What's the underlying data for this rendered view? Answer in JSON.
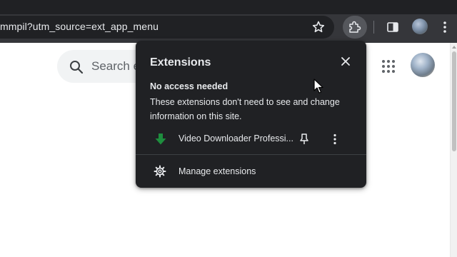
{
  "browser": {
    "omnibox_text": "mmpil?utm_source=ext_app_menu",
    "icons": {
      "star": "bookmark-star-icon",
      "extensions": "puzzle-piece-icon",
      "side_panel": "side-panel-icon",
      "menu": "three-dot-menu-icon"
    }
  },
  "page": {
    "search_placeholder": "Search e",
    "apps_icon": "apps-grid-icon"
  },
  "extensions_popup": {
    "title": "Extensions",
    "section_heading": "No access needed",
    "section_description": "These extensions don't need to see and change information on this site.",
    "extensions": [
      {
        "name": "Video Downloader Professi...",
        "icon": "green-download-arrow-icon"
      }
    ],
    "manage_label": "Manage extensions"
  },
  "colors": {
    "popup_bg": "#202124",
    "toolbar_bg": "#35363a",
    "accent_green": "#1e8e3e"
  }
}
